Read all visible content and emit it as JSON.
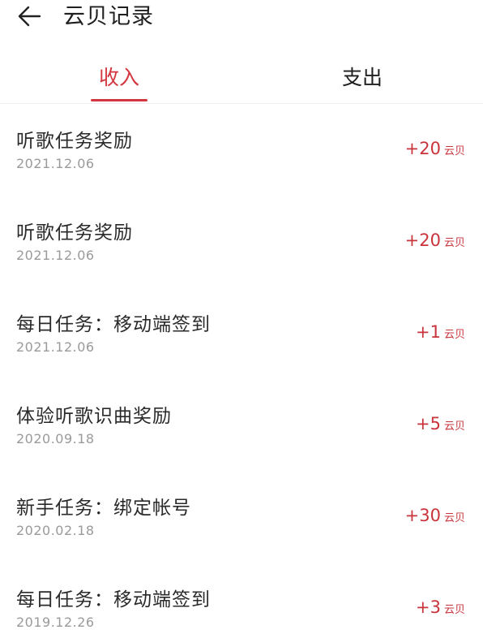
{
  "header": {
    "title": "云贝记录",
    "back_icon": "arrow-left-icon"
  },
  "tabs": [
    {
      "label": "收入",
      "active": true
    },
    {
      "label": "支出",
      "active": false
    }
  ],
  "colors": {
    "accent": "#d4363f",
    "amount": "#c9343c",
    "date": "#9a9a9a"
  },
  "records": [
    {
      "title": "听歌任务奖励",
      "date": "2021.12.06",
      "amount": "+20",
      "unit": "云贝"
    },
    {
      "title": "听歌任务奖励",
      "date": "2021.12.06",
      "amount": "+20",
      "unit": "云贝"
    },
    {
      "title": "每日任务：移动端签到",
      "date": "2021.12.06",
      "amount": "+1",
      "unit": "云贝"
    },
    {
      "title": "体验听歌识曲奖励",
      "date": "2020.09.18",
      "amount": "+5",
      "unit": "云贝"
    },
    {
      "title": "新手任务：绑定帐号",
      "date": "2020.02.18",
      "amount": "+30",
      "unit": "云贝"
    },
    {
      "title": "每日任务：移动端签到",
      "date": "2019.12.26",
      "amount": "+3",
      "unit": "云贝"
    }
  ]
}
